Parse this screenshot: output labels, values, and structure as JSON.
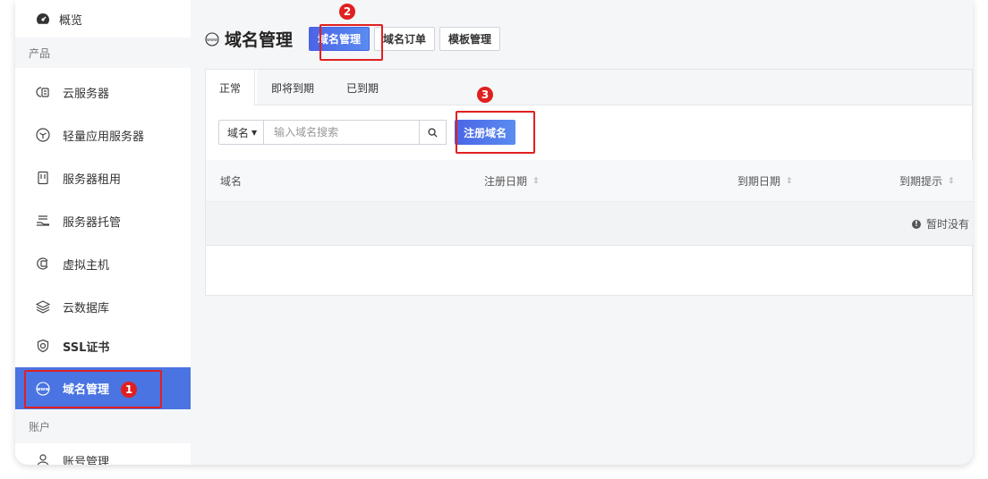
{
  "sidebar": {
    "overview": "概览",
    "section_products": "产品",
    "items": [
      {
        "label": "云服务器",
        "icon": "cloud-server-icon"
      },
      {
        "label": "轻量应用服务器",
        "icon": "cube-icon"
      },
      {
        "label": "服务器租用",
        "icon": "server-rack-icon"
      },
      {
        "label": "服务器托管",
        "icon": "hand-server-icon"
      },
      {
        "label": "虚拟主机",
        "icon": "virtual-host-icon"
      },
      {
        "label": "云数据库",
        "icon": "database-layers-icon"
      },
      {
        "label": "SSL证书",
        "icon": "ssl-shield-icon"
      },
      {
        "label": "域名管理",
        "icon": "www-globe-icon",
        "active": true
      }
    ],
    "section_account": "账户",
    "account_item_partial": "账号管理"
  },
  "header": {
    "title": "域名管理",
    "tabs": [
      "域名管理",
      "域名订单",
      "模板管理"
    ]
  },
  "subtabs": [
    "正常",
    "即将到期",
    "已到期"
  ],
  "search": {
    "select_value": "域名",
    "placeholder": "输入域名搜索",
    "register_label": "注册域名"
  },
  "table": {
    "columns": [
      "域名",
      "注册日期",
      "到期日期",
      "到期提示"
    ],
    "empty_text": "暂时没有"
  },
  "annotations": [
    "1",
    "2",
    "3"
  ],
  "colors": {
    "accent": "#4a74e2",
    "highlight": "#e02020"
  }
}
